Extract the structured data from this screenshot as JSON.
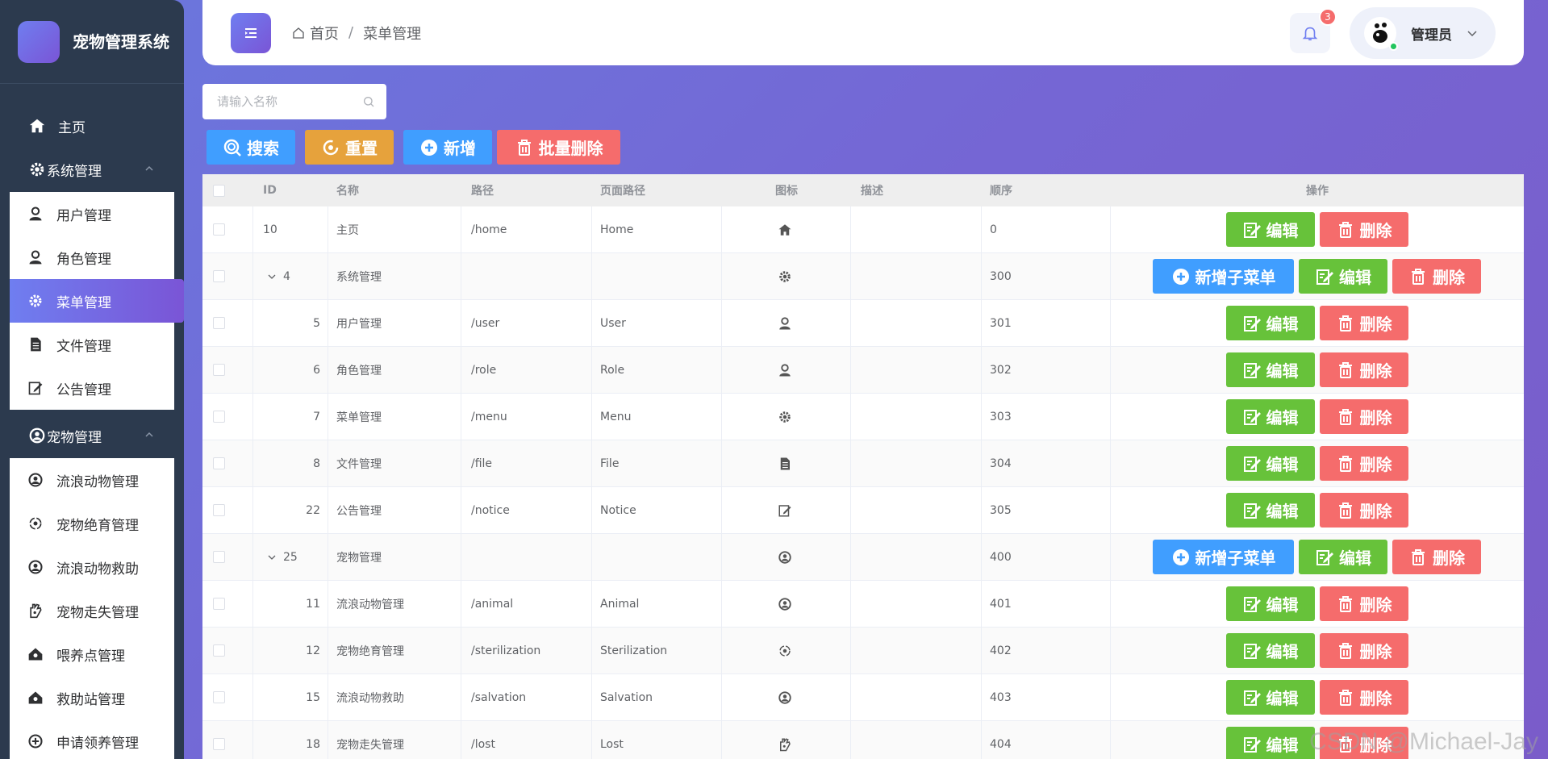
{
  "sidebar": {
    "logo_title": "宠物管理系统",
    "home_label": "主页",
    "groups": [
      {
        "title": "系统管理",
        "items": [
          {
            "label": "用户管理",
            "icon": "user-icon"
          },
          {
            "label": "角色管理",
            "icon": "user-icon"
          },
          {
            "label": "菜单管理",
            "icon": "gear-icon",
            "active": true
          },
          {
            "label": "文件管理",
            "icon": "document-icon"
          },
          {
            "label": "公告管理",
            "icon": "edit-icon"
          }
        ]
      },
      {
        "title": "宠物管理",
        "items": [
          {
            "label": "流浪动物管理",
            "icon": "pet-icon"
          },
          {
            "label": "宠物绝育管理",
            "icon": "sterilize-icon"
          },
          {
            "label": "流浪动物救助",
            "icon": "pet-icon"
          },
          {
            "label": "宠物走失管理",
            "icon": "paw-icon"
          },
          {
            "label": "喂养点管理",
            "icon": "station-icon"
          },
          {
            "label": "救助站管理",
            "icon": "station-icon"
          },
          {
            "label": "申请领养管理",
            "icon": "apply-icon"
          }
        ]
      }
    ]
  },
  "header": {
    "breadcrumb_home": "首页",
    "breadcrumb_sep": "/",
    "breadcrumb_current": "菜单管理",
    "notification_count": "3",
    "user_name": "管理员"
  },
  "toolbar": {
    "search_placeholder": "请输入名称",
    "search_label": "搜索",
    "reset_label": "重置",
    "add_label": "新增",
    "batch_delete_label": "批量删除"
  },
  "table": {
    "columns": [
      "ID",
      "名称",
      "路径",
      "页面路径",
      "图标",
      "描述",
      "顺序",
      "操作"
    ],
    "edit_label": "编辑",
    "delete_label": "删除",
    "add_child_label": "新增子菜单",
    "rows": [
      {
        "id": "10",
        "name": "主页",
        "path": "/home",
        "page": "Home",
        "icon": "home-icon",
        "desc": "",
        "order": "0",
        "level": 0,
        "parent": false
      },
      {
        "id": "4",
        "name": "系统管理",
        "path": "",
        "page": "",
        "icon": "gear-icon",
        "desc": "",
        "order": "300",
        "level": 0,
        "parent": true
      },
      {
        "id": "5",
        "name": "用户管理",
        "path": "/user",
        "page": "User",
        "icon": "user-icon",
        "desc": "",
        "order": "301",
        "level": 1,
        "parent": false
      },
      {
        "id": "6",
        "name": "角色管理",
        "path": "/role",
        "page": "Role",
        "icon": "user-icon",
        "desc": "",
        "order": "302",
        "level": 1,
        "parent": false
      },
      {
        "id": "7",
        "name": "菜单管理",
        "path": "/menu",
        "page": "Menu",
        "icon": "gear-icon",
        "desc": "",
        "order": "303",
        "level": 1,
        "parent": false
      },
      {
        "id": "8",
        "name": "文件管理",
        "path": "/file",
        "page": "File",
        "icon": "document-icon",
        "desc": "",
        "order": "304",
        "level": 1,
        "parent": false
      },
      {
        "id": "22",
        "name": "公告管理",
        "path": "/notice",
        "page": "Notice",
        "icon": "edit-icon",
        "desc": "",
        "order": "305",
        "level": 1,
        "parent": false
      },
      {
        "id": "25",
        "name": "宠物管理",
        "path": "",
        "page": "",
        "icon": "pet-icon",
        "desc": "",
        "order": "400",
        "level": 0,
        "parent": true
      },
      {
        "id": "11",
        "name": "流浪动物管理",
        "path": "/animal",
        "page": "Animal",
        "icon": "pet-icon",
        "desc": "",
        "order": "401",
        "level": 1,
        "parent": false
      },
      {
        "id": "12",
        "name": "宠物绝育管理",
        "path": "/sterilization",
        "page": "Sterilization",
        "icon": "sterilize-icon",
        "desc": "",
        "order": "402",
        "level": 1,
        "parent": false
      },
      {
        "id": "15",
        "name": "流浪动物救助",
        "path": "/salvation",
        "page": "Salvation",
        "icon": "pet-icon",
        "desc": "",
        "order": "403",
        "level": 1,
        "parent": false
      },
      {
        "id": "18",
        "name": "宠物走失管理",
        "path": "/lost",
        "page": "Lost",
        "icon": "paw-icon",
        "desc": "",
        "order": "404",
        "level": 1,
        "parent": false
      }
    ]
  },
  "watermark": "CSDN @Michael-Jay",
  "colors": {
    "primary": "#409eff",
    "success": "#67c23a",
    "warning": "#e6a23c",
    "danger": "#f56c6c",
    "sidebar_bg": "#2c3a4e",
    "accent_gradient_start": "#6f7ef0",
    "accent_gradient_end": "#7a55d6"
  }
}
